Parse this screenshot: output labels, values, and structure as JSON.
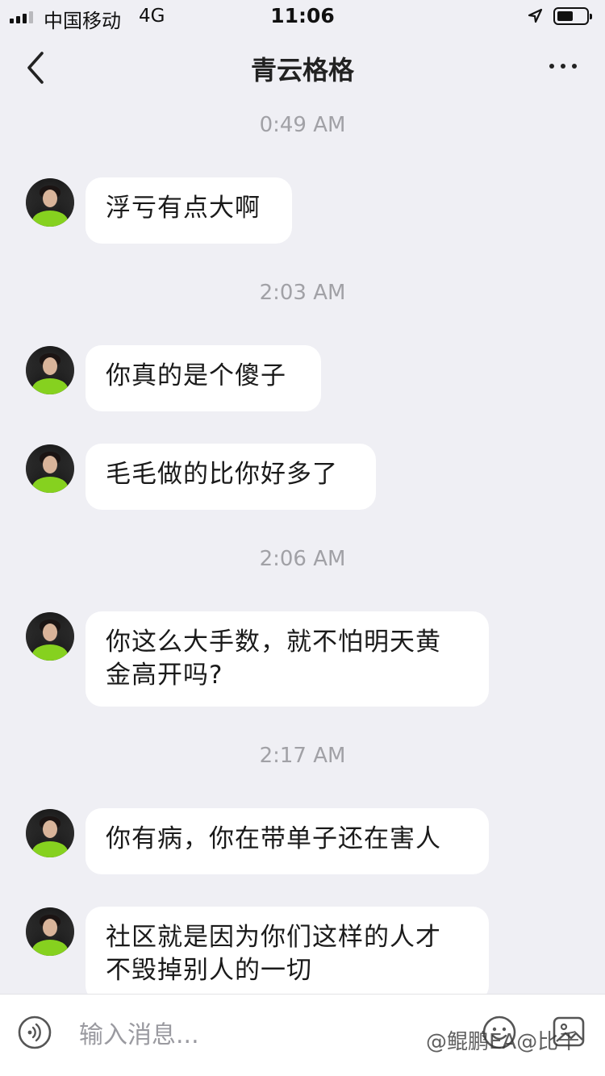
{
  "status_bar": {
    "carrier": "中国移动",
    "network": "4G",
    "time": "11:06",
    "signal_bars": 3,
    "battery_level": 0.55
  },
  "nav": {
    "title": "青云格格",
    "back_icon": "chevron-left-icon",
    "more_icon": "more-horizontal-icon"
  },
  "chat": {
    "timestamps": [
      "0:49 AM",
      "2:03 AM",
      "2:06 AM",
      "2:17 AM"
    ],
    "messages": [
      "浮亏有点大啊",
      "你真的是个傻子",
      "毛毛做的比你好多了",
      "你这么大手数，就不怕明天黄\n金高开吗?",
      "你有病，你在带单子还在害人",
      "社区就是因为你们这样的人才\n不毁掉别人的一切"
    ]
  },
  "input_bar": {
    "placeholder": "输入消息...",
    "voice_icon": "voice-icon",
    "emoji_icon": "emoji-icon",
    "image_icon": "image-icon"
  },
  "watermark": "@鲲鹏EA@比千",
  "colors": {
    "background": "#efeff4",
    "bubble": "#ffffff",
    "timestamp": "#a1a1a6",
    "text": "#1a1a1a"
  }
}
